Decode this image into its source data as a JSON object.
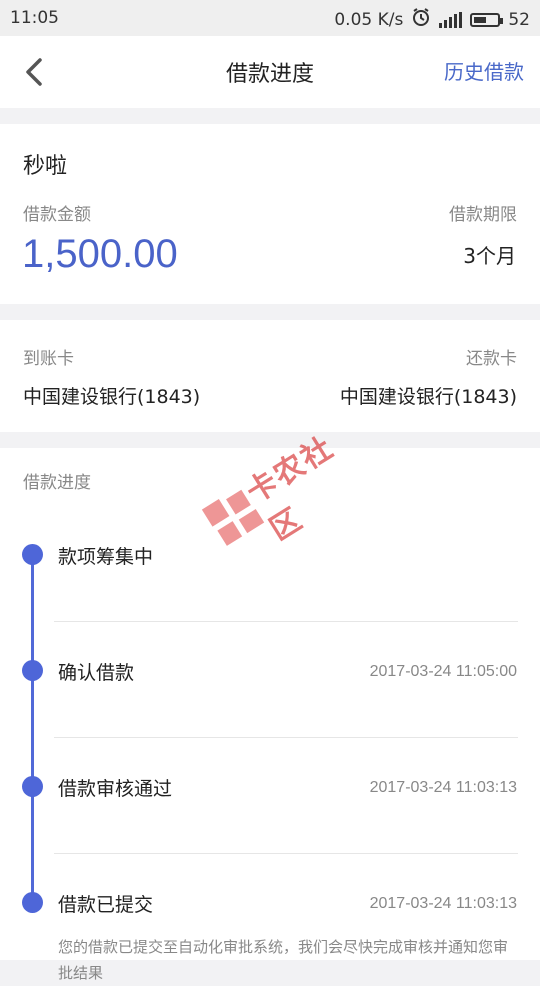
{
  "status_bar": {
    "time": "11:05",
    "speed": "0.05 K/s",
    "network": "4G",
    "battery": "52"
  },
  "nav": {
    "title": "借款进度",
    "history_label": "历史借款"
  },
  "loan": {
    "product_name": "秒啦",
    "amount_label": "借款金额",
    "amount": "1,500.00",
    "term_label": "借款期限",
    "term": "3个月"
  },
  "cards": {
    "receive_label": "到账卡",
    "receive_bank": "中国建设银行(1843)",
    "repay_label": "还款卡",
    "repay_bank": "中国建设银行(1843)"
  },
  "progress": {
    "section_label": "借款进度",
    "steps": [
      {
        "label": "款项筹集中",
        "time": ""
      },
      {
        "label": "确认借款",
        "time": "2017-03-24 11:05:00"
      },
      {
        "label": "借款审核通过",
        "time": "2017-03-24 11:03:13"
      },
      {
        "label": "借款已提交",
        "time": "2017-03-24 11:03:13"
      }
    ],
    "submitted_desc": "您的借款已提交至自动化审批系统，我们会尽快完成审核并通知您审批结果"
  },
  "watermark_text": "卡农社区",
  "colors": {
    "accent": "#4a63c9",
    "timeline": "#4e66d8",
    "watermark": "#d94040"
  }
}
